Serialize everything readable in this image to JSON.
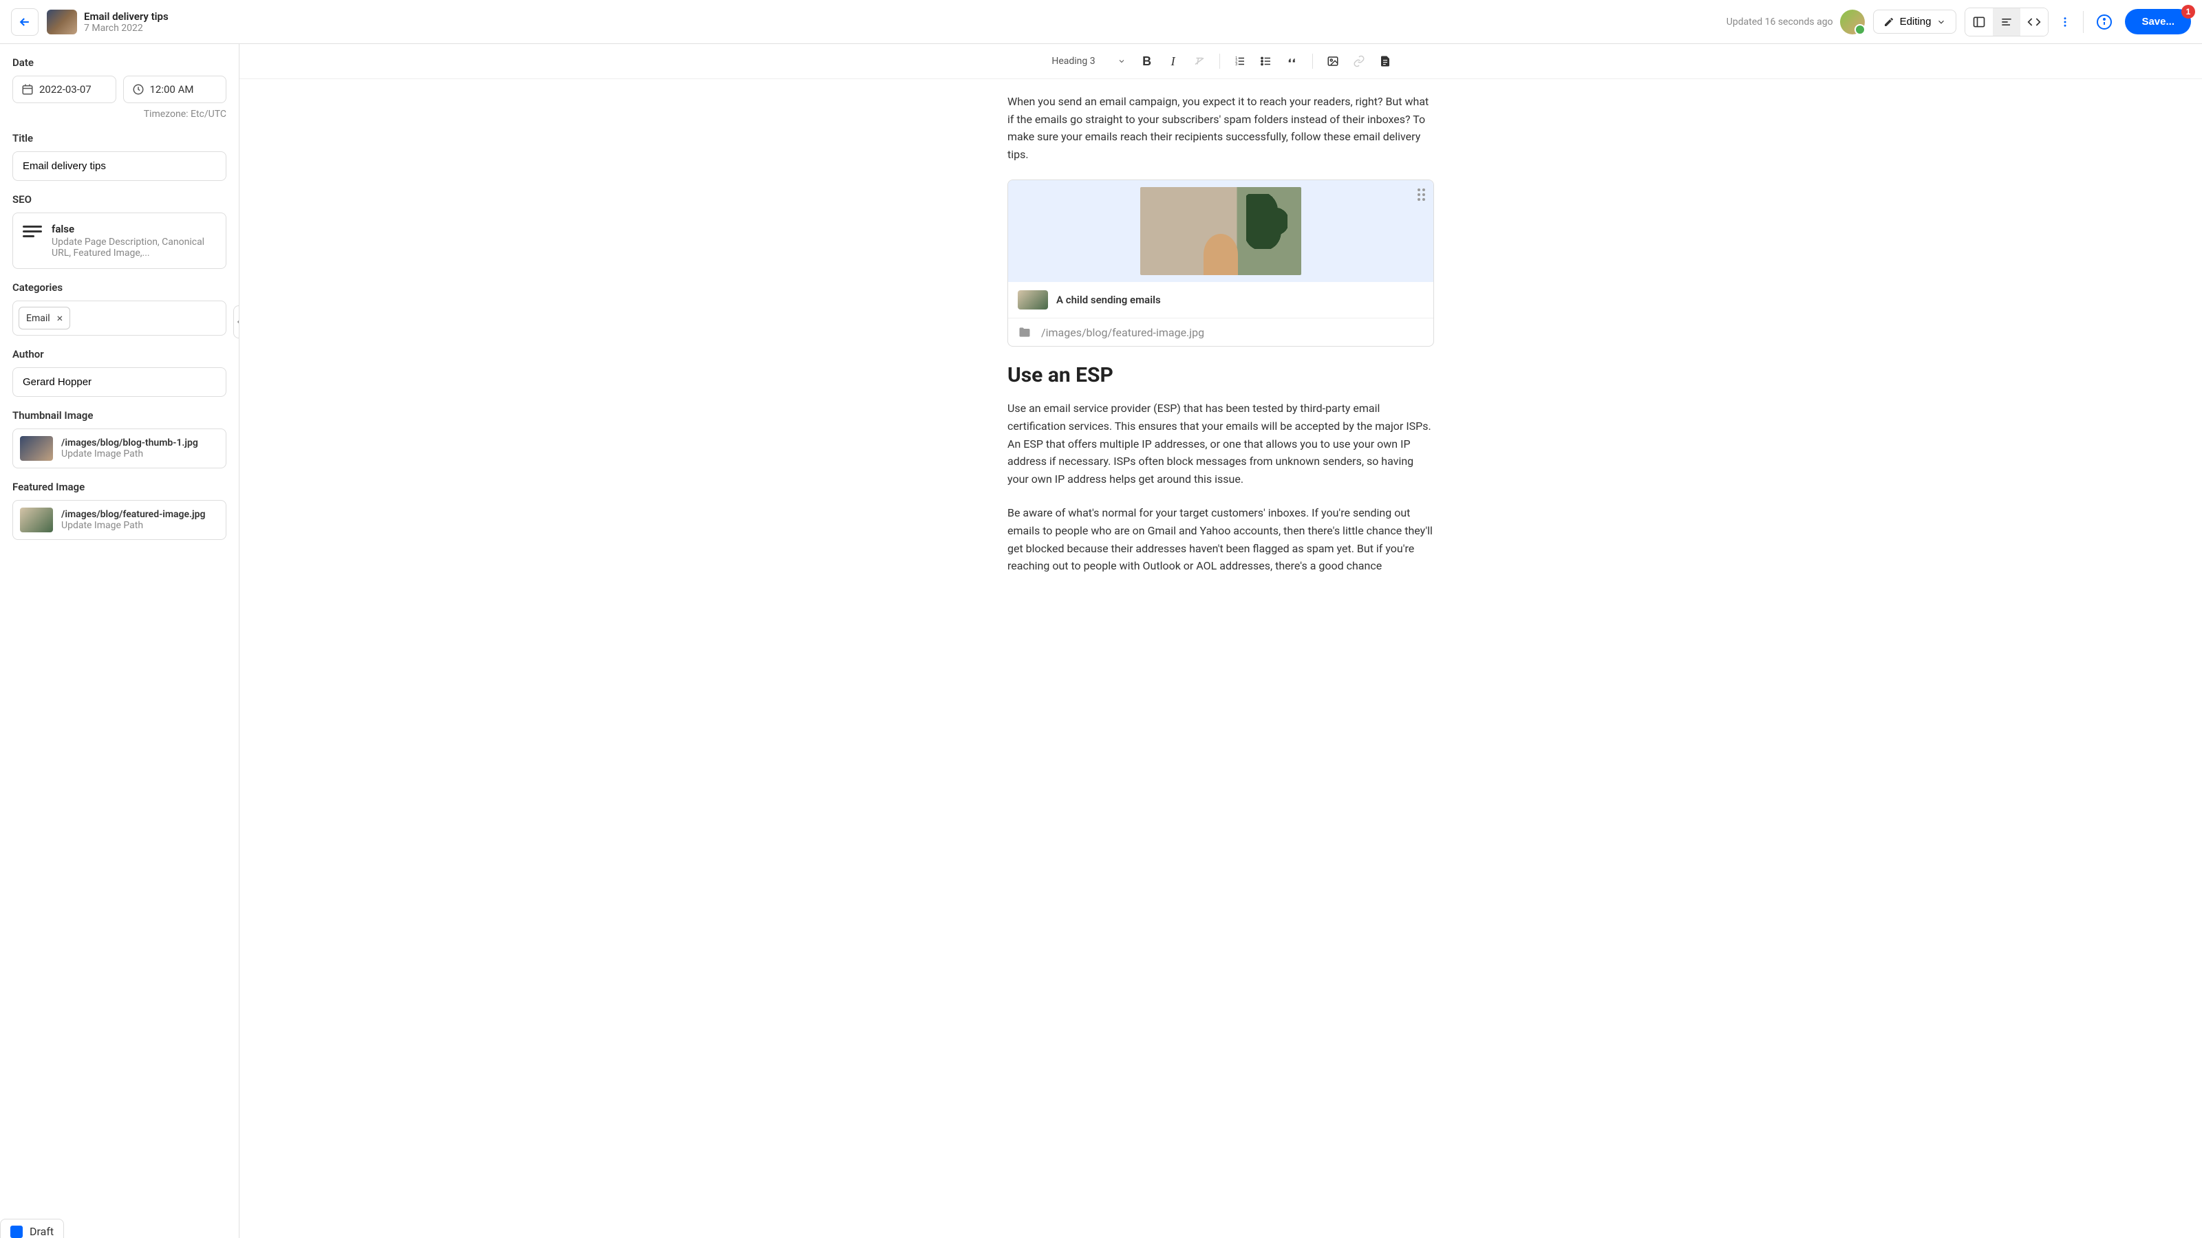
{
  "header": {
    "title": "Email delivery tips",
    "date": "7 March 2022",
    "updated": "Updated 16 seconds ago",
    "editing_label": "Editing",
    "save_label": "Save...",
    "save_badge": "1"
  },
  "sidebar": {
    "date_label": "Date",
    "date_value": "2022-03-07",
    "time_value": "12:00 AM",
    "timezone": "Timezone: Etc/UTC",
    "title_label": "Title",
    "title_value": "Email delivery tips",
    "seo_label": "SEO",
    "seo_value": "false",
    "seo_desc": "Update Page Description, Canonical URL, Featured Image,...",
    "categories_label": "Categories",
    "category_tag": "Email",
    "author_label": "Author",
    "author_value": "Gerard Hopper",
    "thumb_label": "Thumbnail Image",
    "thumb_path": "/images/blog/blog-thumb-1.jpg",
    "thumb_sub": "Update Image Path",
    "featured_label": "Featured Image",
    "featured_path": "/images/blog/featured-image.jpg",
    "featured_sub": "Update Image Path",
    "draft_tab": "Draft"
  },
  "toolbar": {
    "heading": "Heading 3"
  },
  "content": {
    "para1": "When you send an email campaign, you expect it to reach your readers, right? But what if the emails go straight to your subscribers' spam folders instead of their inboxes? To make sure your emails reach their recipients successfully, follow these email delivery tips.",
    "image_caption": "A child sending emails",
    "image_path": "/images/blog/featured-image.jpg",
    "h3": "Use an ESP",
    "para2": "Use an email service provider (ESP) that has been tested by third-party email certification services. This ensures that your emails will be accepted by the major ISPs. An ESP that offers multiple IP addresses, or one that allows you to use your own IP address if necessary. ISPs often block messages from unknown senders, so having your own IP address helps get around this issue.",
    "para3": "Be aware of what's normal for your target customers' inboxes. If you're sending out emails to people who are on Gmail and Yahoo accounts, then there's little chance they'll get blocked because their addresses haven't been flagged as spam yet. But if you're reaching out to people with Outlook or AOL addresses, there's a good chance"
  }
}
